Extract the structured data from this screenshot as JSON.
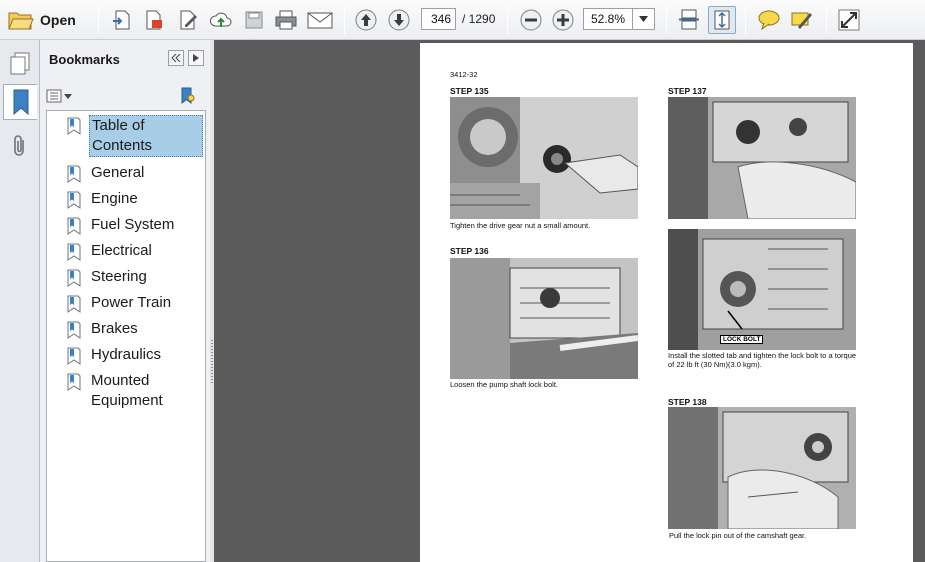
{
  "toolbar": {
    "open_label": "Open",
    "page_current": "346",
    "page_total": "/ 1290",
    "zoom": "52.8%"
  },
  "bookmarks": {
    "title": "Bookmarks",
    "items": [
      {
        "label": "Table of Contents"
      },
      {
        "label": "General"
      },
      {
        "label": "Engine"
      },
      {
        "label": "Fuel System"
      },
      {
        "label": "Electrical"
      },
      {
        "label": "Steering"
      },
      {
        "label": "Power Train"
      },
      {
        "label": "Brakes"
      },
      {
        "label": "Hydraulics"
      },
      {
        "label": "Mounted Equipment"
      }
    ],
    "selected_index": 0
  },
  "document": {
    "page_ref": "3412-32",
    "step135": {
      "title": "STEP 135",
      "caption": "Tighten the drive gear nut a small amount."
    },
    "step136": {
      "title": "STEP 136",
      "caption": "Loosen the pump shaft lock bolt."
    },
    "step137": {
      "title": "STEP 137",
      "caption": "Install the slotted tab and tighten the lock bolt to a torque of 22 lb ft (30 Nm)(3.0 kgm).",
      "callout": "LOCK BOLT"
    },
    "step138": {
      "title": "STEP 138",
      "caption": "Pull the lock pin out of the camshaft gear."
    }
  },
  "colors": {
    "accent_selection": "#a8cde6",
    "doc_background": "#5b5b5b",
    "toolbar_icon_blue": "#3b6ea5"
  }
}
